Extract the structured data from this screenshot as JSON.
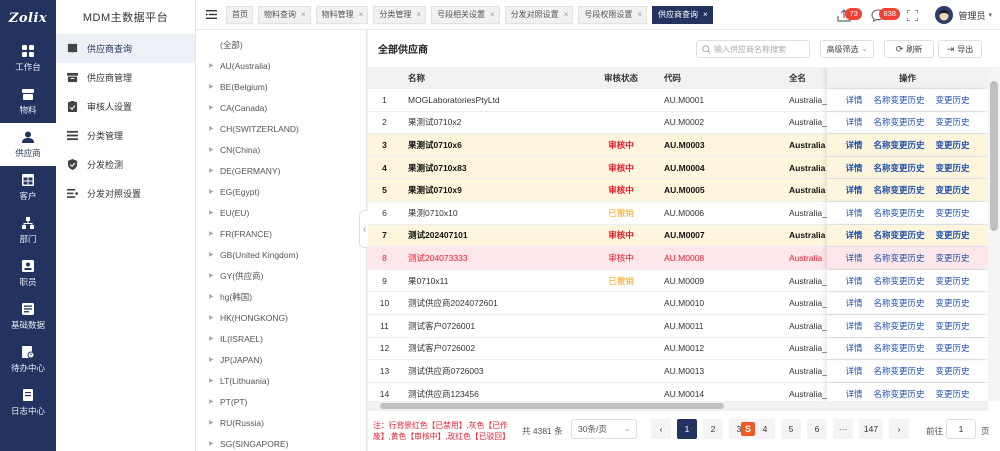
{
  "logo": "Zolix",
  "rail": [
    {
      "label": "工作台",
      "icon": "grid-icon"
    },
    {
      "label": "物料",
      "icon": "box-icon"
    },
    {
      "label": "供应商",
      "icon": "person-icon"
    },
    {
      "label": "客户",
      "icon": "table-icon"
    },
    {
      "label": "部门",
      "icon": "org-icon"
    },
    {
      "label": "职员",
      "icon": "staff-icon"
    },
    {
      "label": "基础数据",
      "icon": "data-icon"
    },
    {
      "label": "待办中心",
      "icon": "todo-icon"
    },
    {
      "label": "日志中心",
      "icon": "log-icon"
    }
  ],
  "sidebar": {
    "title": "MDM主数据平台",
    "items": [
      {
        "label": "供应商查询",
        "icon": "book-icon"
      },
      {
        "label": "供应商管理",
        "icon": "archive-icon"
      },
      {
        "label": "审核人设置",
        "icon": "clipboard-icon"
      },
      {
        "label": "分类管理",
        "icon": "list-icon"
      },
      {
        "label": "分发检测",
        "icon": "shield-icon"
      },
      {
        "label": "分发对照设置",
        "icon": "settings-list-icon"
      }
    ]
  },
  "tabs": [
    {
      "label": "首页",
      "closable": false
    },
    {
      "label": "物料查询",
      "closable": true
    },
    {
      "label": "物料管理",
      "closable": true
    },
    {
      "label": "分类管理",
      "closable": true
    },
    {
      "label": "号段相关设置",
      "closable": true
    },
    {
      "label": "分发对照设置",
      "closable": true
    },
    {
      "label": "号段权限设置",
      "closable": true
    },
    {
      "label": "供应商查询",
      "closable": true
    }
  ],
  "header": {
    "notify_badge": "73",
    "message_badge": "838",
    "user_name": "管理员"
  },
  "tree": [
    "(全部)",
    "AU(Australia)",
    "BE(Belgium)",
    "CA(Canada)",
    "CH(SWITZERLAND)",
    "CN(China)",
    "DE(GERMANY)",
    "EG(Egypt)",
    "EU(EU)",
    "FR(FRANCE)",
    "GB(United Kingdom)",
    "GY(供应商)",
    "hg(韩国)",
    "HK(HONGKONG)",
    "IL(ISRAEL)",
    "JP(JAPAN)",
    "LT(Lithuania)",
    "PT(PT)",
    "RU(Russia)",
    "SG(SINGAPORE)"
  ],
  "main": {
    "title": "全部供应商",
    "search_placeholder": "输入供应商名称搜索",
    "filter_label": "高级筛选",
    "refresh_label": "刷新",
    "export_label": "导出"
  },
  "table": {
    "headers": [
      "",
      "名称",
      "审核状态",
      "代码",
      "全名",
      "操作"
    ],
    "actions": [
      "详情",
      "名称变更历史",
      "变更历史"
    ],
    "rows": [
      {
        "no": "1",
        "name": "MOGLaboratoriesPtyLtd",
        "status": "",
        "code": "AU.M0001",
        "full": "Australia_",
        "style": ""
      },
      {
        "no": "2",
        "name": "果测试0710x2",
        "status": "",
        "code": "AU.M0002",
        "full": "Australia_",
        "style": ""
      },
      {
        "no": "3",
        "name": "果测试0710x6",
        "status": "审核中",
        "code": "AU.M0003",
        "full": "Australia",
        "style": "yellow"
      },
      {
        "no": "4",
        "name": "果测试0710x83",
        "status": "审核中",
        "code": "AU.M0004",
        "full": "Australia",
        "style": "yellow"
      },
      {
        "no": "5",
        "name": "果测试0710x9",
        "status": "审核中",
        "code": "AU.M0005",
        "full": "Australia",
        "style": "yellow"
      },
      {
        "no": "6",
        "name": "果测0710x10",
        "status": "已撤销",
        "code": "AU.M0006",
        "full": "Australia_",
        "style": ""
      },
      {
        "no": "7",
        "name": "测试202407101",
        "status": "审核中",
        "code": "AU.M0007",
        "full": "Australia",
        "style": "yellow"
      },
      {
        "no": "8",
        "name": "测试204073333",
        "status": "审核中",
        "code": "AU.M0008",
        "full": "Australia",
        "style": "pink"
      },
      {
        "no": "9",
        "name": "果0710x11",
        "status": "已撤销",
        "code": "AU.M0009",
        "full": "Australia_",
        "style": ""
      },
      {
        "no": "10",
        "name": "测试供应商2024072601",
        "status": "",
        "code": "AU.M0010",
        "full": "Australia_",
        "style": ""
      },
      {
        "no": "11",
        "name": "测试客户0726001",
        "status": "",
        "code": "AU.M0011",
        "full": "Australia_",
        "style": ""
      },
      {
        "no": "12",
        "name": "测试客户0726002",
        "status": "",
        "code": "AU.M0012",
        "full": "Australia_",
        "style": ""
      },
      {
        "no": "13",
        "name": "测试供应商0726003",
        "status": "",
        "code": "AU.M0013",
        "full": "Australia_",
        "style": ""
      },
      {
        "no": "14",
        "name": "测试供应商123456",
        "status": "",
        "code": "AU.M0014",
        "full": "Australia_",
        "style": ""
      }
    ]
  },
  "footer": {
    "note": "注：行背景红色【已禁用】,灰色【已作废】,黄色【审核中】,玫红色【已驳回】",
    "total": "共 4381 条",
    "page_size": "30条/页",
    "pages": [
      "1",
      "2",
      "3",
      "4",
      "5",
      "6",
      "···",
      "147"
    ],
    "goto_label": "前往",
    "goto_value": "1",
    "goto_suffix": "页"
  },
  "colors": {
    "primary": "#233360",
    "row_yellow": "#fdf6dd",
    "row_pink": "#fde7ea",
    "status_red": "#e81b2d",
    "status_orange": "#f7a21b",
    "badge": "#f04134"
  }
}
